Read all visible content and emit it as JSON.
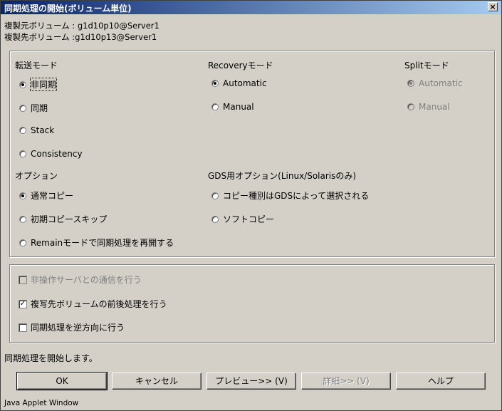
{
  "window": {
    "title": "同期処理の開始(ボリューム単位)",
    "close_label": "×"
  },
  "info": {
    "source": "複製元ボリューム : g1d10p10@Server1",
    "destination": "複製先ボリューム :g1d10p13@Server1"
  },
  "transfer_mode": {
    "label": "転送モード",
    "options": [
      "非同期",
      "同期",
      "Stack",
      "Consistency"
    ],
    "selected": "非同期"
  },
  "recovery_mode": {
    "label": "Recoveryモード",
    "options": [
      "Automatic",
      "Manual"
    ],
    "selected": "Automatic"
  },
  "split_mode": {
    "label": "Splitモード",
    "options": [
      "Automatic",
      "Manual"
    ],
    "selected": "Automatic",
    "enabled": false
  },
  "options": {
    "label": "オプション",
    "items": [
      "通常コピー",
      "初期コピースキップ",
      "Remainモードで同期処理を再開する"
    ],
    "selected": "通常コピー"
  },
  "gds_options": {
    "label": "GDS用オプション(Linux/Solarisのみ)",
    "items": [
      "コピー種別はGDSによって選択される",
      "ソフトコピー"
    ],
    "selected": null
  },
  "checkboxes": [
    {
      "label": "非操作サーバとの通信を行う",
      "checked": false,
      "enabled": false
    },
    {
      "label": "複写先ボリュームの前後処理を行う",
      "checked": true,
      "enabled": true
    },
    {
      "label": "同期処理を逆方向に行う",
      "checked": false,
      "enabled": true
    }
  ],
  "status_text": "同期処理を開始します。",
  "buttons": {
    "ok": "OK",
    "cancel": "キャンセル",
    "preview": "プレビュー>> (V)",
    "details": "詳細>> (V)",
    "help": "ヘルプ"
  },
  "applet_label": "Java Applet Window",
  "colors": {
    "title_start": "#0a246a",
    "title_end": "#a6caf0",
    "face": "#d4d0c8",
    "disabled_text": "#808080"
  }
}
